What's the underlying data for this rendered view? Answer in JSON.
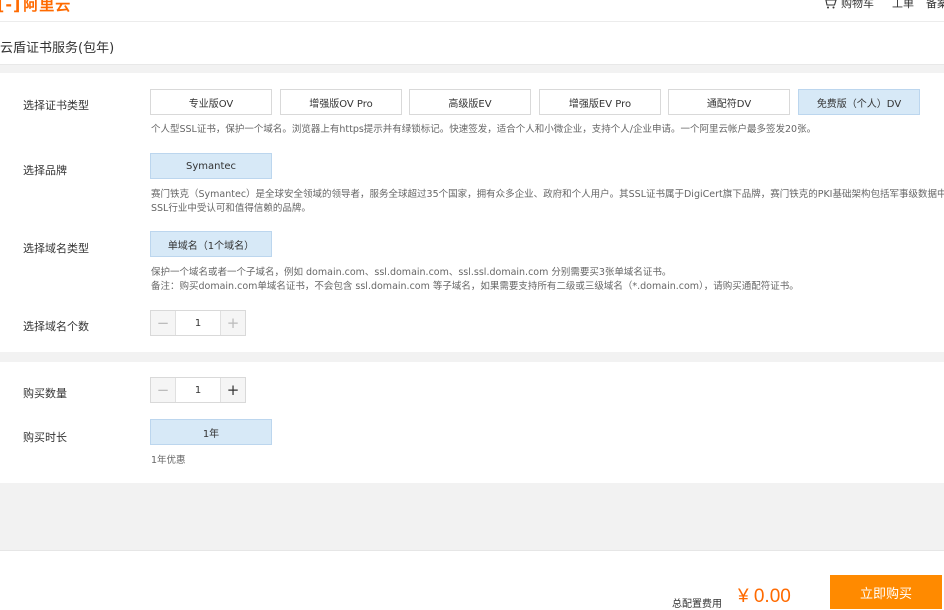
{
  "header": {
    "logo_bracket": "[-]",
    "logo_text": "阿里云",
    "cart_label": "购物车",
    "ticket_label": "工单",
    "filing_label": "备案"
  },
  "title": "云盾证书服务(包年)",
  "cert_type": {
    "label": "选择证书类型",
    "options": [
      "专业版OV",
      "增强版OV Pro",
      "高级版EV",
      "增强版EV Pro",
      "通配符DV",
      "免费版（个人）DV"
    ],
    "selected_index": 5,
    "description": "个人型SSL证书，保护一个域名。浏览器上有https提示并有绿锁标记。快速签发，适合个人和小微企业，支持个人/企业申请。一个阿里云帐户最多签发20张。"
  },
  "brand": {
    "label": "选择品牌",
    "option": "Symantec",
    "description_line1": "赛门铁克（Symantec）是全球安全领域的领导者，服务全球超过35个国家，拥有众多企业、政府和个人用户。其SSL证书属于DigiCert旗下品牌，赛门铁克的PKI基础架构包括军事级数据中心",
    "description_line2": "SSL行业中受认可和值得信赖的品牌。"
  },
  "domain_type": {
    "label": "选择域名类型",
    "option": "单域名（1个域名）",
    "description_line1": "保护一个域名或者一个子域名，例如 domain.com、ssl.domain.com、ssl.ssl.domain.com 分别需要买3张单域名证书。",
    "description_line2": "备注：购买domain.com单域名证书，不会包含 ssl.domain.com 等子域名，如果需要支持所有二级或三级域名（*.domain.com），请购买通配符证书。"
  },
  "domain_count": {
    "label": "选择域名个数",
    "value": "1",
    "minus": "−",
    "plus": "+"
  },
  "quantity": {
    "label": "购买数量",
    "value": "1",
    "minus": "−",
    "plus": "+"
  },
  "duration": {
    "label": "购买时长",
    "option": "1年",
    "note": "1年优惠"
  },
  "footer": {
    "total_label": "总配置费用",
    "price": "¥ 0.00",
    "buy_label": "立即购买"
  },
  "colors": {
    "brand": "#ff6a00",
    "buy_button": "#ff8a00",
    "selected_bg": "#d7e9f7"
  }
}
